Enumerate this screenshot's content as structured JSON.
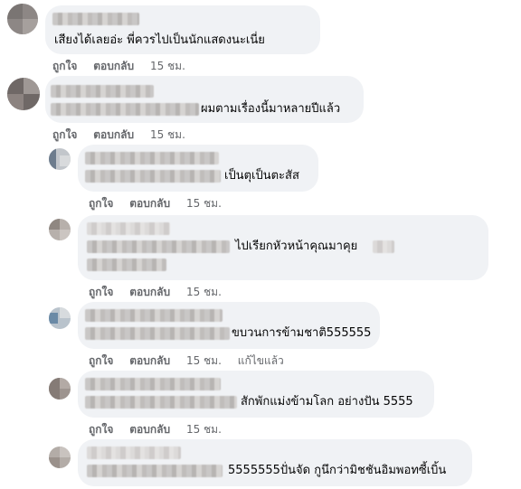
{
  "comments": [
    {
      "text": "เสียงได้เลยอ่ะ พี่ควรไปเป็นนักแสดงนะเนี่ย",
      "like": "ถูกใจ",
      "reply": "ตอบกลับ",
      "time": "15 ชม."
    },
    {
      "text": "ผมตามเรื่องนี้มาหลายปีแล้ว",
      "like": "ถูกใจ",
      "reply": "ตอบกลับ",
      "time": "15 ชม."
    },
    {
      "text": "เป็นตุเป็นตะสัส",
      "like": "ถูกใจ",
      "reply": "ตอบกลับ",
      "time": "15 ชม."
    },
    {
      "text": "ไปเรียกหัวหน้าคุณมาคุย",
      "like": "ถูกใจ",
      "reply": "ตอบกลับ",
      "time": "15 ชม."
    },
    {
      "text": "ขบวนการข้ามชาติ555555",
      "like": "ถูกใจ",
      "reply": "ตอบกลับ",
      "time": "15 ชม.",
      "edited": "แก้ไขแล้ว"
    },
    {
      "text": "สักพักแม่งข้ามโลก อย่างปัน 5555",
      "like": "ถูกใจ",
      "reply": "ตอบกลับ",
      "time": "15 ชม."
    },
    {
      "text": "5555555ปั่นจัด กูนึกว่ามิชชันอิมพอทซี้เบิ้น"
    }
  ]
}
